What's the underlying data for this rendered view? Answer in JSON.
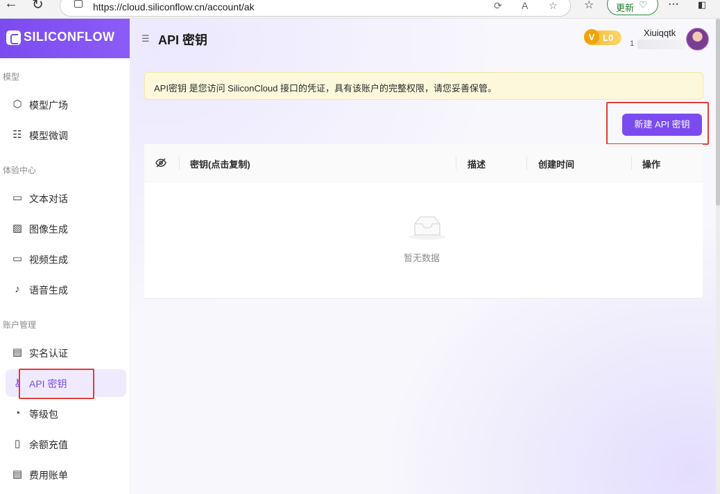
{
  "browser": {
    "url": "https://cloud.siliconflow.cn/account/ak",
    "update_label": "更新"
  },
  "sidebar": {
    "logo_text": "SILICONFLOW",
    "sections": [
      {
        "label": "模型"
      },
      {
        "label": "体验中心"
      },
      {
        "label": "账户管理"
      }
    ],
    "items": [
      {
        "label": "模型广场",
        "icon": "cube-icon"
      },
      {
        "label": "模型微调",
        "icon": "sliders-icon"
      },
      {
        "label": "文本对话",
        "icon": "chat-icon"
      },
      {
        "label": "图像生成",
        "icon": "image-icon"
      },
      {
        "label": "视频生成",
        "icon": "video-icon"
      },
      {
        "label": "语音生成",
        "icon": "mic-icon"
      },
      {
        "label": "实名认证",
        "icon": "id-card-icon"
      },
      {
        "label": "API 密钥",
        "icon": "key-icon",
        "active": true
      },
      {
        "label": "等级包",
        "icon": "gauge-icon"
      },
      {
        "label": "余额充值",
        "icon": "wallet-icon"
      },
      {
        "label": "费用账单",
        "icon": "bill-icon"
      }
    ]
  },
  "header": {
    "title": "API 密钥",
    "level_badge": "L0",
    "level_badge_prefix": "V",
    "user_name": "Xiuiqqtk",
    "user_sub": "1"
  },
  "notice": {
    "text": "API密钥 是您访问 SiliconCloud 接口的凭证，具有该账户的完整权限，请您妥善保管。"
  },
  "actions": {
    "new_key_label": "新建 API 密钥"
  },
  "table": {
    "columns": [
      "密钥(点击复制)",
      "描述",
      "创建时间",
      "操作"
    ],
    "rows": [],
    "empty_text": "暂无数据"
  },
  "colors": {
    "accent": "#7b4bf0",
    "notice_bg": "#fdf8dc",
    "highlight": "#e53935"
  }
}
